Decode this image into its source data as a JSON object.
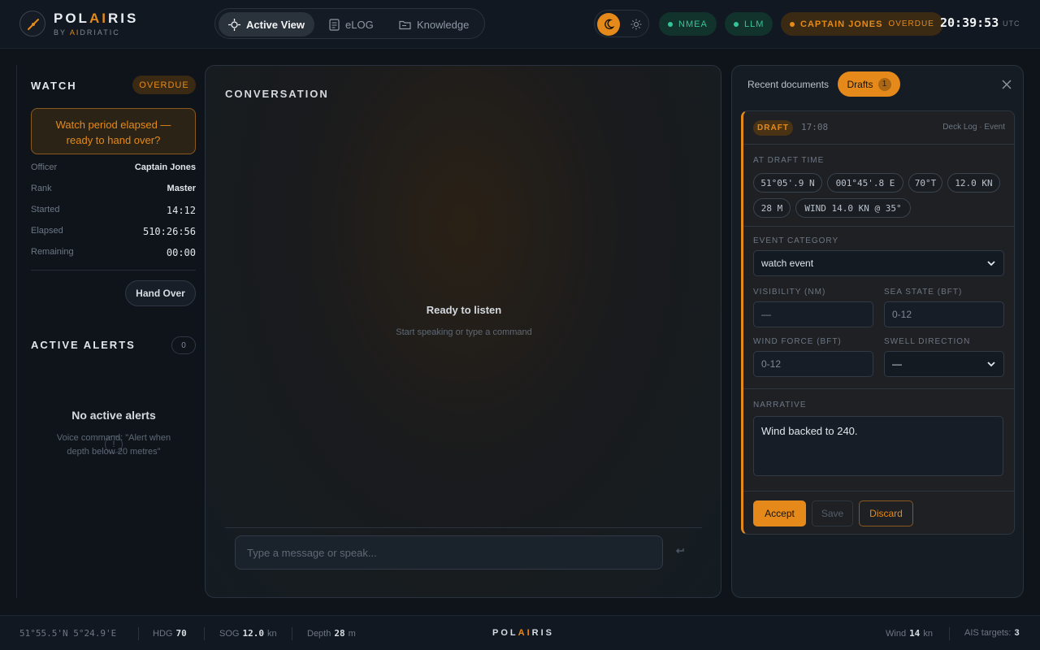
{
  "brand": {
    "pre": "POL",
    "accent": "AI",
    "post": "RIS",
    "sub_pre": "BY ",
    "sub_accent": "AI",
    "sub_post": "DRIATIC"
  },
  "nav": {
    "active_view": "Active View",
    "elog": "eLOG",
    "knowledge": "Knowledge"
  },
  "status": {
    "nmea": "NMEA",
    "llm": "LLM",
    "captain": "CAPTAIN JONES",
    "captain_status": "OVERDUE"
  },
  "clock": {
    "time": "20:39:53",
    "tz": "UTC"
  },
  "watch": {
    "title": "WATCH",
    "badge": "OVERDUE",
    "elapsed_msg_1": "Watch period elapsed —",
    "elapsed_msg_2": "ready to hand over?",
    "officer_label": "Officer",
    "officer": "Captain Jones",
    "rank_label": "Rank",
    "rank": "Master",
    "started_label": "Started",
    "started": "14:12",
    "elapsed_label": "Elapsed",
    "elapsed": "510:26:56",
    "remaining_label": "Remaining",
    "remaining": "00:00",
    "handover": "Hand Over"
  },
  "alerts": {
    "title": "ACTIVE ALERTS",
    "count": "0",
    "empty_title": "No active alerts",
    "empty_hint": "Voice command: \"Alert when depth below 20 metres\""
  },
  "conversation": {
    "title": "CONVERSATION",
    "ready": "Ready to listen",
    "ready_sub": "Start speaking or type a command",
    "input_placeholder": "Type a message or speak..."
  },
  "drafts_panel": {
    "tab_recent": "Recent documents",
    "tab_drafts": "Drafts",
    "drafts_count": "1",
    "card": {
      "badge": "DRAFT",
      "time": "17:08",
      "meta": "Deck Log · Event",
      "at_draft_label": "AT DRAFT TIME",
      "chips": [
        "51°05'.9 N",
        "001°45'.8 E",
        "70°T",
        "12.0 KN",
        "28 M",
        "WIND 14.0 KN @ 35°"
      ],
      "event_category_label": "EVENT CATEGORY",
      "event_category": "watch event",
      "visibility_label": "VISIBILITY (NM)",
      "visibility": "—",
      "sea_state_label": "SEA STATE (BFT)",
      "sea_state": "0-12",
      "wind_force_label": "WIND FORCE (BFT)",
      "wind_force": "0-12",
      "swell_label": "SWELL DIRECTION",
      "swell": "—",
      "narrative_label": "NARRATIVE",
      "narrative": "Wind backed to 240.",
      "accept": "Accept",
      "save": "Save",
      "discard": "Discard"
    }
  },
  "footer": {
    "position": "51°55.5'N 5°24.9'E",
    "hdg_label": "HDG",
    "hdg": "70",
    "sog_label": "SOG",
    "sog": "12.0",
    "sog_unit": "kn",
    "depth_label": "Depth",
    "depth": "28",
    "depth_unit": "m",
    "brand_pre": "POL",
    "brand_accent": "AI",
    "brand_post": "RIS",
    "wind_label": "Wind",
    "wind": "14",
    "wind_unit": "kn",
    "ais_label": "AIS targets:",
    "ais": "3"
  },
  "colors": {
    "accent": "#e58a1a",
    "ok": "#35c59a",
    "bg": "#0f141b"
  },
  "icons": [
    "compass-icon",
    "crosshair-icon",
    "document-icon",
    "folder-icon",
    "moon-icon",
    "sun-icon",
    "info-icon",
    "send-icon",
    "close-icon",
    "chevron-down-icon"
  ]
}
